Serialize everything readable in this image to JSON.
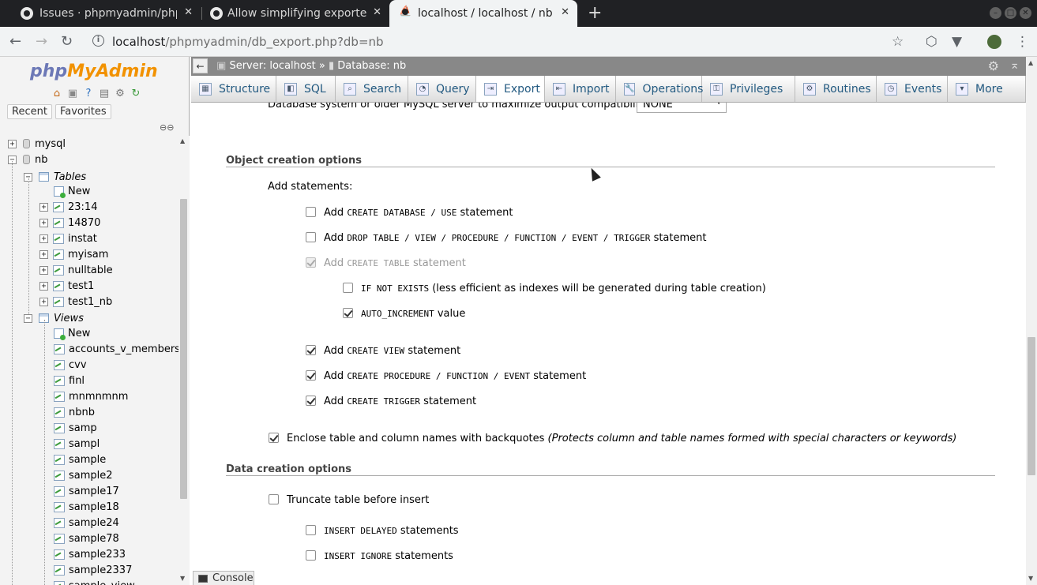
{
  "browser": {
    "tabs": [
      {
        "title": "Issues · phpmyadmin/php"
      },
      {
        "title": "Allow simplifying exporte"
      },
      {
        "title": "localhost / localhost / nb"
      }
    ],
    "new_tab": "+",
    "url_host": "localhost",
    "url_path": "/phpmyadmin/db_export.php?db=nb",
    "info": "i"
  },
  "pma": {
    "logo_php": "php",
    "logo_myadmin": "MyAdmin",
    "recent": "Recent",
    "favorites": "Favorites",
    "tree": {
      "dbs": [
        "mysql",
        "nb"
      ],
      "tables_label": "Tables",
      "new_label": "New",
      "tables": [
        "23:14",
        "14870",
        "instat",
        "myisam",
        "nulltable",
        "test1",
        "test1_nb"
      ],
      "views_label": "Views",
      "views": [
        "accounts_v_members",
        "cvv",
        "finl",
        "mnmnmnm",
        "nbnb",
        "samp",
        "sampl",
        "sample",
        "sample2",
        "sample17",
        "sample18",
        "sample24",
        "sample78",
        "sample233",
        "sample2337",
        "sample_view"
      ]
    },
    "breadcrumb": {
      "server": "Server: localhost",
      "sep": "»",
      "database": "Database: nb"
    },
    "menu": [
      "Structure",
      "SQL",
      "Search",
      "Query",
      "Export",
      "Import",
      "Operations",
      "Privileges",
      "Routines",
      "Events",
      "More"
    ],
    "content": {
      "compat_text": "Database system or older MySQL server to maximize output compatibility with:",
      "compat_value": "NONE",
      "object_legend": "Object creation options",
      "add_statements": "Add statements:",
      "opt_create_db": {
        "pre": "Add",
        "code": "CREATE DATABASE / USE",
        "post": "statement",
        "checked": false
      },
      "opt_drop": {
        "pre": "Add",
        "code": "DROP TABLE / VIEW / PROCEDURE / FUNCTION / EVENT / TRIGGER",
        "post": "statement",
        "checked": false
      },
      "opt_create_table": {
        "pre": "Add",
        "code": "CREATE TABLE",
        "post": "statement",
        "checked": true,
        "disabled": true
      },
      "opt_if_not_exists": {
        "code": "IF NOT EXISTS",
        "post": "(less efficient as indexes will be generated during table creation)",
        "checked": false
      },
      "opt_auto_inc": {
        "code": "AUTO_INCREMENT",
        "post": "value",
        "checked": true
      },
      "opt_create_view": {
        "pre": "Add",
        "code": "CREATE VIEW",
        "post": "statement",
        "checked": true
      },
      "opt_create_proc": {
        "pre": "Add",
        "code": "CREATE PROCEDURE / FUNCTION / EVENT",
        "post": "statement",
        "checked": true
      },
      "opt_create_trigger": {
        "pre": "Add",
        "code": "CREATE TRIGGER",
        "post": "statement",
        "checked": true
      },
      "opt_backquotes": {
        "label": "Enclose table and column names with backquotes",
        "note": "(Protects column and table names formed with special characters or keywords)",
        "checked": true
      },
      "data_legend": "Data creation options",
      "opt_truncate": {
        "label": "Truncate table before insert",
        "checked": false
      },
      "opt_insert_delayed": {
        "code": "INSERT DELAYED",
        "post": "statements",
        "checked": false
      },
      "opt_insert_ignore": {
        "code": "INSERT IGNORE",
        "post": "statements",
        "checked": false
      }
    },
    "console": "Console"
  }
}
